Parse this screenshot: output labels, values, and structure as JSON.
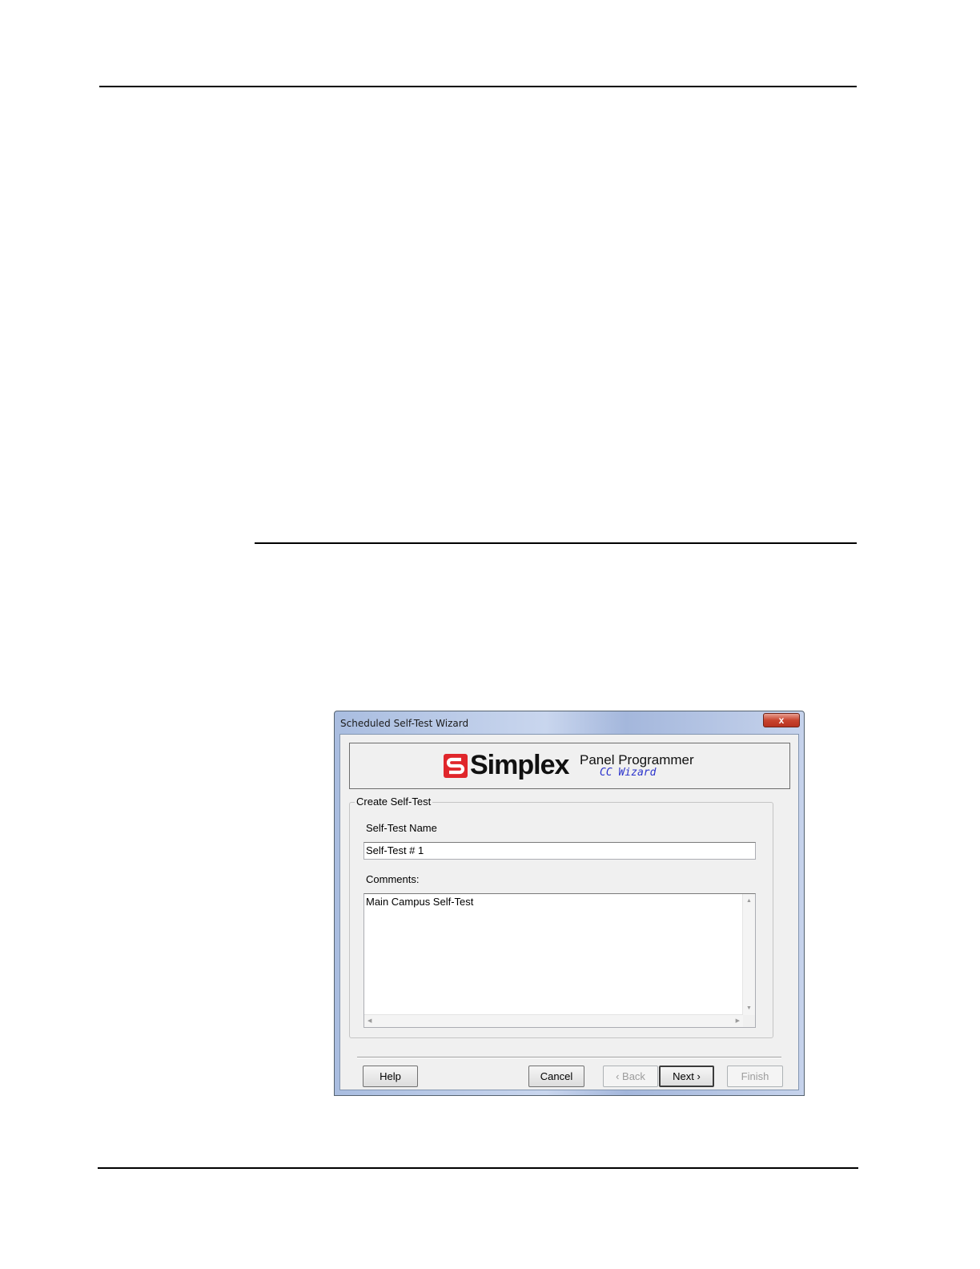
{
  "window": {
    "title": "Scheduled Self-Test Wizard",
    "close_glyph": "x"
  },
  "banner": {
    "logo_icon": "simplex-logo-icon",
    "brand": "Simplex",
    "app_name": "Panel Programmer",
    "app_sub": "CC Wizard"
  },
  "group": {
    "legend": "Create Self-Test",
    "name_label": "Self-Test Name",
    "name_value": "Self-Test # 1",
    "comments_label": "Comments:",
    "comments_value": "Main Campus Self-Test"
  },
  "buttons": {
    "help": "Help",
    "cancel": "Cancel",
    "back": "‹ Back",
    "next": "Next ›",
    "finish": "Finish"
  },
  "colors": {
    "logo_red": "#e0262b",
    "subtitle_blue": "#2b33cc"
  }
}
